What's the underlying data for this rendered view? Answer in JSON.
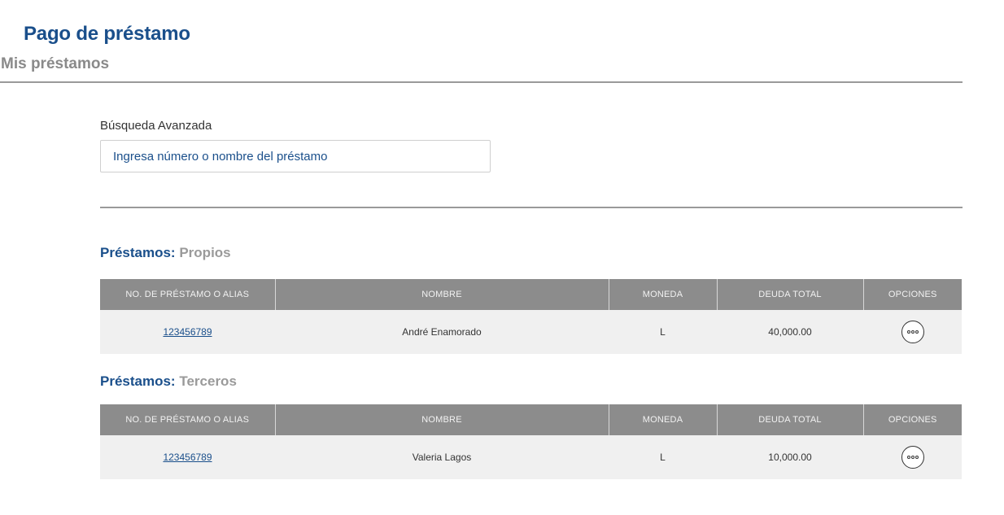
{
  "header": {
    "title": "Pago de préstamo",
    "subtitle": "Mis préstamos"
  },
  "search": {
    "label": "Búsqueda Avanzada",
    "placeholder": "Ingresa número o nombre del préstamo",
    "value": ""
  },
  "columns": [
    "NO. DE PRÉSTAMO O ALIAS",
    "NOMBRE",
    "MONEDA",
    "DEUDA TOTAL",
    "OPCIONES"
  ],
  "sections": [
    {
      "title_strong": "Préstamos:",
      "title_light": "Propios",
      "rows": [
        {
          "loan_number": "123456789",
          "name": "André Enamorado",
          "currency": "L",
          "total_debt": "40,000.00",
          "options_icon": "ellipsis-circle-icon"
        }
      ]
    },
    {
      "title_strong": "Préstamos:",
      "title_light": "Terceros",
      "rows": [
        {
          "loan_number": "123456789",
          "name": "Valeria Lagos",
          "currency": "L",
          "total_debt": "10,000.00",
          "options_icon": "ellipsis-circle-icon"
        }
      ]
    }
  ],
  "colors": {
    "brand_blue": "#1a4f8b",
    "header_gray": "#8c8c8c",
    "row_bg": "#f0f0f0"
  }
}
